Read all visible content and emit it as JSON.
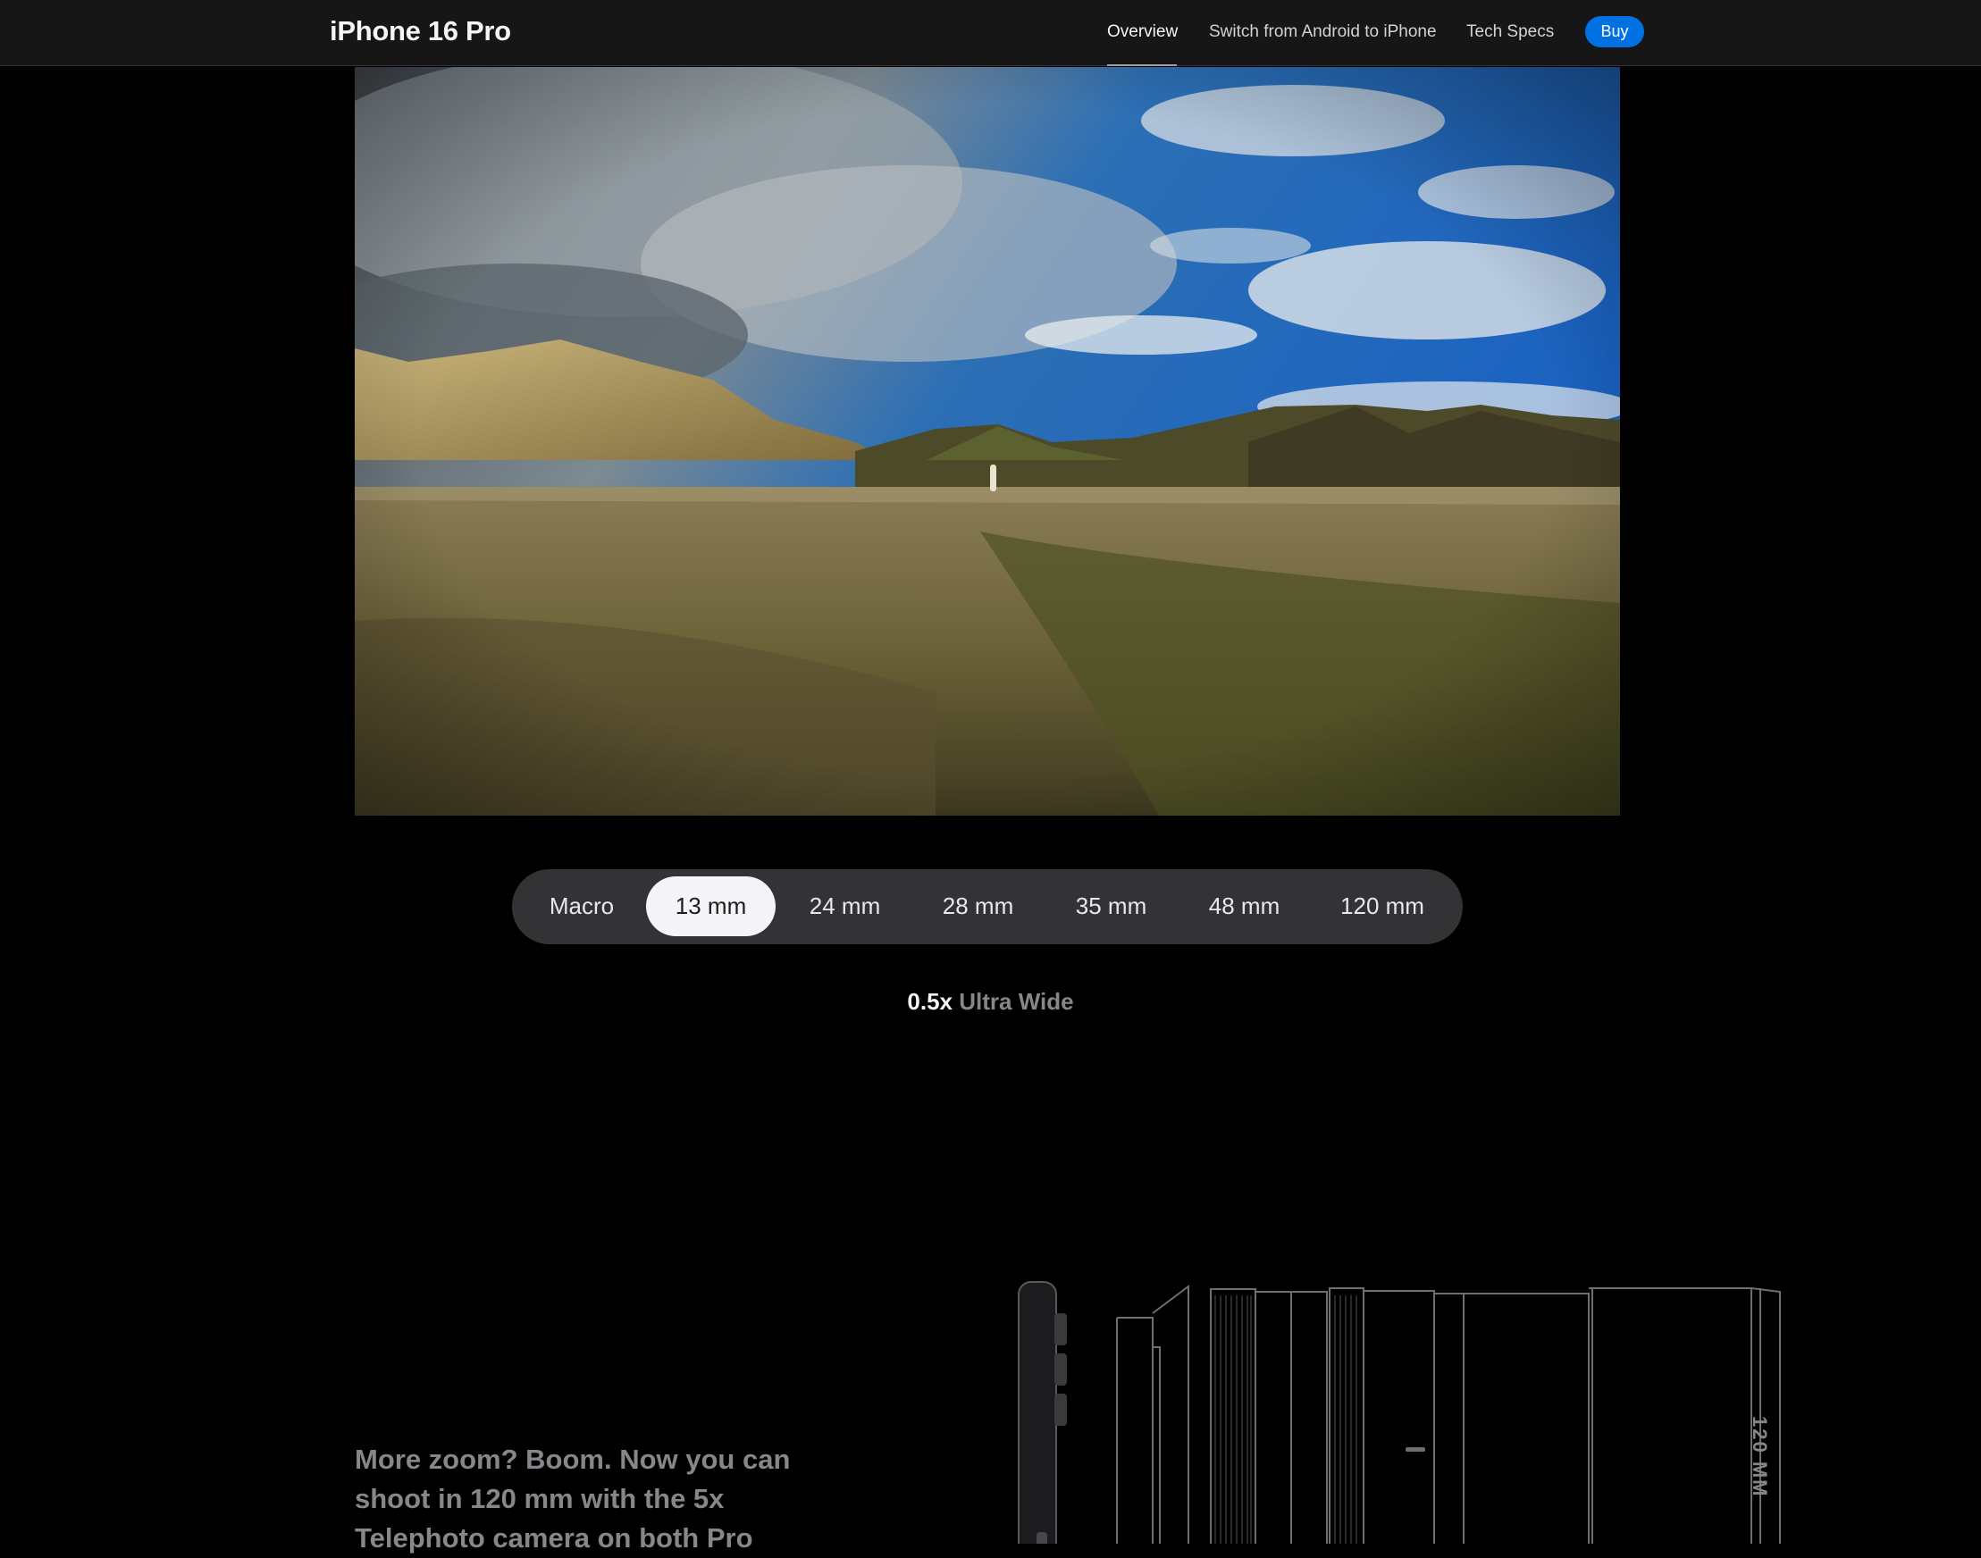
{
  "nav": {
    "title": "iPhone 16 Pro",
    "links": [
      {
        "label": "Overview",
        "active": true
      },
      {
        "label": "Switch from Android to iPhone",
        "active": false
      },
      {
        "label": "Tech Specs",
        "active": false
      }
    ],
    "buy_label": "Buy",
    "buy_color": "#0071e3"
  },
  "lens_selector": {
    "options": [
      "Macro",
      "13 mm",
      "24 mm",
      "28 mm",
      "35 mm",
      "48 mm",
      "120 mm"
    ],
    "selected": "13 mm"
  },
  "zoom_caption": {
    "zoom": "0.5x",
    "lens": "Ultra Wide"
  },
  "promo": {
    "text": "More zoom? Boom. Now you can shoot in 120 mm with the 5x Telephoto camera on both Pro"
  },
  "lens_drawing": {
    "label": "120 MM"
  }
}
